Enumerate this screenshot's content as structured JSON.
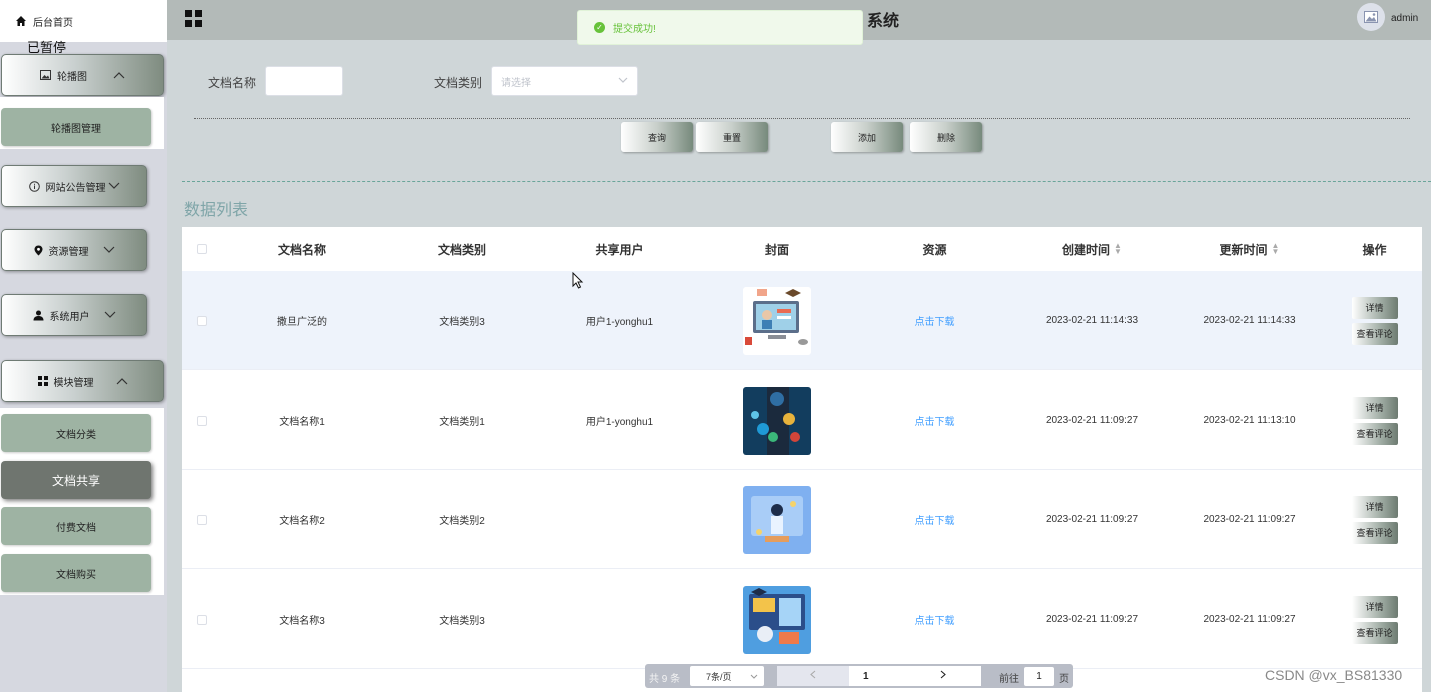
{
  "sidebar": {
    "home_label": "后台首页",
    "overlay_text": "已暂停",
    "menus": [
      {
        "label": "轮播图",
        "icon": "image-icon",
        "expanded": true
      },
      {
        "label": "网站公告管理",
        "icon": "info-icon",
        "expanded": false
      },
      {
        "label": "资源管理",
        "icon": "location-icon",
        "expanded": false
      },
      {
        "label": "系统用户",
        "icon": "user-icon",
        "expanded": false
      },
      {
        "label": "模块管理",
        "icon": "grid-icon",
        "expanded": true
      }
    ],
    "carousel_sub": [
      "轮播图管理"
    ],
    "module_sub": [
      "文档分类",
      "文档共享",
      "付费文档",
      "文档购买"
    ],
    "active_sub": "文档共享"
  },
  "header": {
    "title": "系统",
    "user": "admin"
  },
  "toast": {
    "message": "提交成功!",
    "color": "#67c23a"
  },
  "filters": {
    "name_label": "文档名称",
    "name_value": "",
    "type_label": "文档类别",
    "type_placeholder": "请选择"
  },
  "actions": {
    "query": "查询",
    "reset": "重置",
    "add": "添加",
    "delete": "删除"
  },
  "section_title": "数据列表",
  "table": {
    "headers": [
      "文档名称",
      "文档类别",
      "共享用户",
      "封面",
      "资源",
      "创建时间",
      "更新时间",
      "操作"
    ],
    "rows": [
      {
        "name": "撒旦广泛的",
        "type": "文档类别3",
        "user": "用户1-yonghu1",
        "resource": "点击下载",
        "created": "2023-02-21 11:14:33",
        "updated": "2023-02-21 11:14:33",
        "detail": "详情",
        "comment": "查看评论"
      },
      {
        "name": "文档名称1",
        "type": "文档类别1",
        "user": "用户1-yonghu1",
        "resource": "点击下载",
        "created": "2023-02-21 11:09:27",
        "updated": "2023-02-21 11:13:10",
        "detail": "详情",
        "comment": "查看评论"
      },
      {
        "name": "文档名称2",
        "type": "文档类别2",
        "user": "",
        "resource": "点击下载",
        "created": "2023-02-21 11:09:27",
        "updated": "2023-02-21 11:09:27",
        "detail": "详情",
        "comment": "查看评论"
      },
      {
        "name": "文档名称3",
        "type": "文档类别3",
        "user": "",
        "resource": "点击下载",
        "created": "2023-02-21 11:09:27",
        "updated": "2023-02-21 11:09:27",
        "detail": "详情",
        "comment": "查看评论"
      }
    ]
  },
  "pagination": {
    "total": "共 9 条",
    "page_size": "7条/页",
    "current": "1",
    "goto_label": "前往",
    "goto_value": "1",
    "page_unit": "页"
  },
  "watermark": "CSDN @vx_BS81330"
}
